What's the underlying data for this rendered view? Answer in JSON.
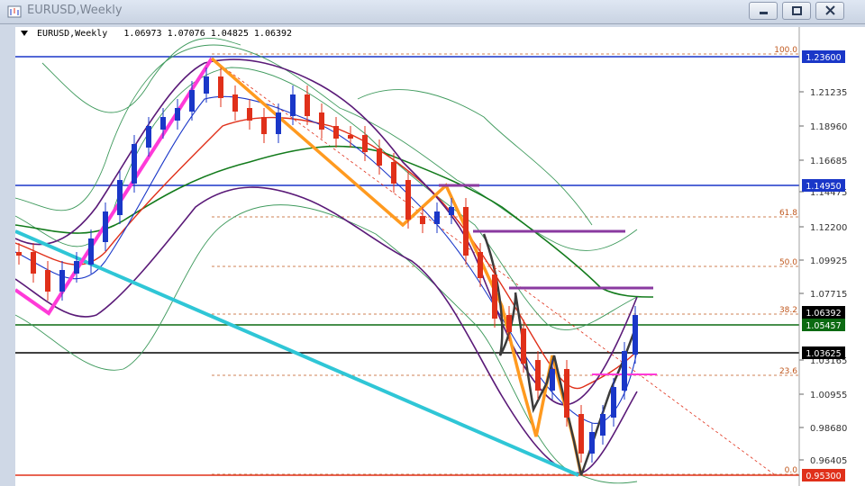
{
  "window": {
    "title": "EURUSD,Weekly",
    "buttons": [
      "minimize",
      "restore",
      "close"
    ]
  },
  "chart_header": {
    "symbol": "EURUSD,Weekly",
    "ohlc": "1.06973 1.07076 1.04825 1.06392"
  },
  "price_axis": {
    "ticks": [
      "1.21235",
      "1.18960",
      "1.16685",
      "1.14475",
      "1.12200",
      "1.09925",
      "1.07715",
      "1.03165",
      "1.00955",
      "0.98680",
      "0.96405"
    ]
  },
  "price_tags": [
    {
      "label": "1.23600",
      "bg": "#1a37c8",
      "fg": "#ffffff"
    },
    {
      "label": "1.14950",
      "bg": "#1a37c8",
      "fg": "#ffffff"
    },
    {
      "label": "1.06392",
      "bg": "#000000",
      "fg": "#ffffff"
    },
    {
      "label": "1.05457",
      "bg": "#0c6a12",
      "fg": "#ffffff"
    },
    {
      "label": "1.03625",
      "bg": "#000000",
      "fg": "#ffffff"
    },
    {
      "label": "0.95300",
      "bg": "#e0301a",
      "fg": "#ffffff"
    }
  ],
  "fib_levels": [
    "100.0",
    "61.8",
    "50.0",
    "38.2",
    "23.6",
    "0.0"
  ],
  "colors": {
    "blue_line": "#1a37c8",
    "green_line": "#0c6a12",
    "red_line": "#e0301a",
    "fib": "#c0581e",
    "magenta": "#ff3ad8",
    "orange": "#ff9a1f",
    "cyan": "#2fc6d6",
    "purple": "#7a1f8a",
    "ma_green": "#137b1c",
    "band": "#3f9a5d"
  }
}
